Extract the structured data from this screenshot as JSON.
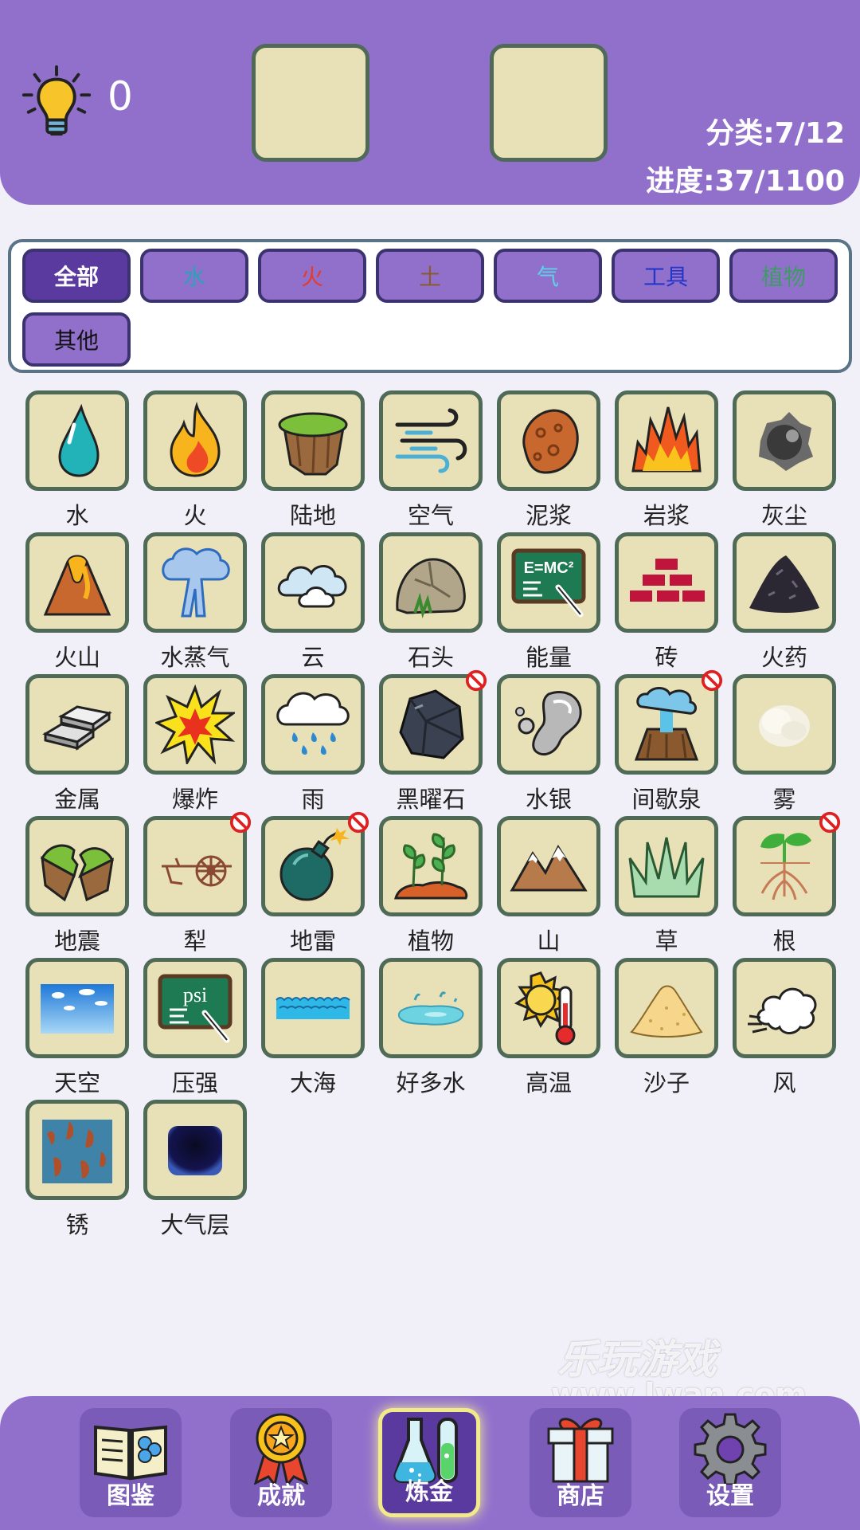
{
  "header": {
    "hint_count": "0",
    "category_label": "分类:7/12",
    "progress_label": "进度:37/1100"
  },
  "filters": [
    {
      "label": "全部",
      "color": "#ffffff",
      "active": true
    },
    {
      "label": "水",
      "color": "#2aa2b8"
    },
    {
      "label": "火",
      "color": "#e53b2b"
    },
    {
      "label": "土",
      "color": "#8a5a2e"
    },
    {
      "label": "气",
      "color": "#5fd0e8"
    },
    {
      "label": "工具",
      "color": "#2336c8"
    },
    {
      "label": "植物",
      "color": "#3f9a66"
    },
    {
      "label": "其他",
      "color": "#111111"
    }
  ],
  "elements": [
    {
      "name": "水",
      "icon": "water-drop-icon"
    },
    {
      "name": "火",
      "icon": "fire-icon"
    },
    {
      "name": "陆地",
      "icon": "land-icon"
    },
    {
      "name": "空气",
      "icon": "air-icon"
    },
    {
      "name": "泥浆",
      "icon": "mud-icon"
    },
    {
      "name": "岩浆",
      "icon": "lava-icon"
    },
    {
      "name": "灰尘",
      "icon": "dust-icon"
    },
    {
      "name": "火山",
      "icon": "volcano-icon"
    },
    {
      "name": "水蒸气",
      "icon": "steam-icon"
    },
    {
      "name": "云",
      "icon": "cloud-icon"
    },
    {
      "name": "石头",
      "icon": "stone-icon"
    },
    {
      "name": "能量",
      "icon": "energy-icon"
    },
    {
      "name": "砖",
      "icon": "brick-icon"
    },
    {
      "name": "火药",
      "icon": "gunpowder-icon"
    },
    {
      "name": "金属",
      "icon": "metal-icon"
    },
    {
      "name": "爆炸",
      "icon": "explosion-icon"
    },
    {
      "name": "雨",
      "icon": "rain-icon"
    },
    {
      "name": "黑曜石",
      "icon": "obsidian-icon",
      "locked": true
    },
    {
      "name": "水银",
      "icon": "mercury-icon"
    },
    {
      "name": "间歇泉",
      "icon": "geyser-icon",
      "locked": true
    },
    {
      "name": "雾",
      "icon": "fog-icon"
    },
    {
      "name": "地震",
      "icon": "earthquake-icon"
    },
    {
      "name": "犁",
      "icon": "plow-icon",
      "locked": true
    },
    {
      "name": "地雷",
      "icon": "landmine-icon",
      "locked": true
    },
    {
      "name": "植物",
      "icon": "plant-icon"
    },
    {
      "name": "山",
      "icon": "mountain-icon"
    },
    {
      "name": "草",
      "icon": "grass-icon"
    },
    {
      "name": "根",
      "icon": "root-icon",
      "locked": true
    },
    {
      "name": "天空",
      "icon": "sky-icon"
    },
    {
      "name": "压强",
      "icon": "pressure-icon"
    },
    {
      "name": "大海",
      "icon": "sea-icon"
    },
    {
      "name": "好多水",
      "icon": "puddle-icon"
    },
    {
      "name": "高温",
      "icon": "heat-icon"
    },
    {
      "name": "沙子",
      "icon": "sand-icon"
    },
    {
      "name": "风",
      "icon": "wind-icon"
    },
    {
      "name": "锈",
      "icon": "rust-icon"
    },
    {
      "name": "大气层",
      "icon": "atmosphere-icon"
    }
  ],
  "watermark": {
    "line1": "乐玩游戏",
    "line2": "www.lwan.com"
  },
  "nav": [
    {
      "label": "图鉴",
      "icon": "book-icon"
    },
    {
      "label": "成就",
      "icon": "medal-icon"
    },
    {
      "label": "炼金",
      "icon": "flask-icon",
      "active": true
    },
    {
      "label": "商店",
      "icon": "gift-icon"
    },
    {
      "label": "设置",
      "icon": "gear-icon"
    }
  ]
}
